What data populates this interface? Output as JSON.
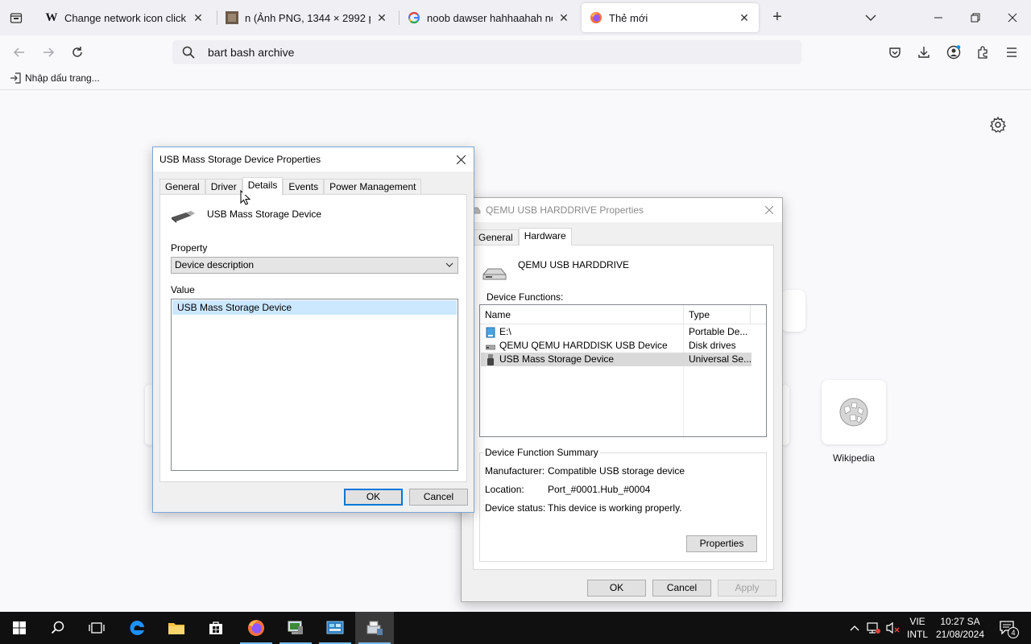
{
  "browser": {
    "tabs": [
      {
        "label": "Change network icon click actio",
        "favicon": "wikipedia-w"
      },
      {
        "label": "n (Ảnh PNG, 1344 × 2992 pixel)",
        "favicon": "image-thumb"
      },
      {
        "label": "noob dawser hahhaahah noob - T",
        "favicon": "google-g"
      },
      {
        "label": "Thẻ mới",
        "favicon": "firefox-logo"
      }
    ],
    "active_tab": 3,
    "url_value": "bart bash archive",
    "bookmark_label": "Nhập dấu trang...",
    "top_site_label": "Wikipedia"
  },
  "usb_dialog": {
    "title": "USB Mass Storage Device Properties",
    "tabs": [
      "General",
      "Driver",
      "Details",
      "Events",
      "Power Management"
    ],
    "selected_tab": "Details",
    "device_name": "USB Mass Storage Device",
    "property_label": "Property",
    "property_value": "Device description",
    "value_label": "Value",
    "value_item": "USB Mass Storage Device",
    "ok_label": "OK",
    "cancel_label": "Cancel"
  },
  "qemu_dialog": {
    "title": "QEMU USB HARDDRIVE Properties",
    "tabs": [
      "General",
      "Hardware"
    ],
    "selected_tab": "Hardware",
    "device_name": "QEMU USB HARDDRIVE",
    "functions_label": "Device Functions:",
    "columns": [
      "Name",
      "Type"
    ],
    "rows": [
      {
        "name": "E:\\",
        "type": "Portable De...",
        "icon": "drive-icon"
      },
      {
        "name": "QEMU QEMU HARDDISK USB Device",
        "type": "Disk drives",
        "icon": "disk-icon"
      },
      {
        "name": "USB Mass Storage Device",
        "type": "Universal Se...",
        "icon": "usb-icon"
      }
    ],
    "selected_row": 2,
    "summary_label": "Device Function Summary",
    "manufacturer_label": "Manufacturer:",
    "manufacturer_value": "Compatible USB storage device",
    "location_label": "Location:",
    "location_value": "Port_#0001.Hub_#0004",
    "status_label": "Device status:",
    "status_value": "This device is working properly.",
    "properties_label": "Properties",
    "ok_label": "OK",
    "cancel_label": "Cancel",
    "apply_label": "Apply"
  },
  "taskbar": {
    "language": "VIE",
    "layout": "INTL",
    "time": "10:27 SA",
    "date": "21/08/2024",
    "notifications": "4"
  },
  "colors": {
    "accent": "#0078d7",
    "selection": "#cce8ff",
    "taskbar": "#101010"
  }
}
